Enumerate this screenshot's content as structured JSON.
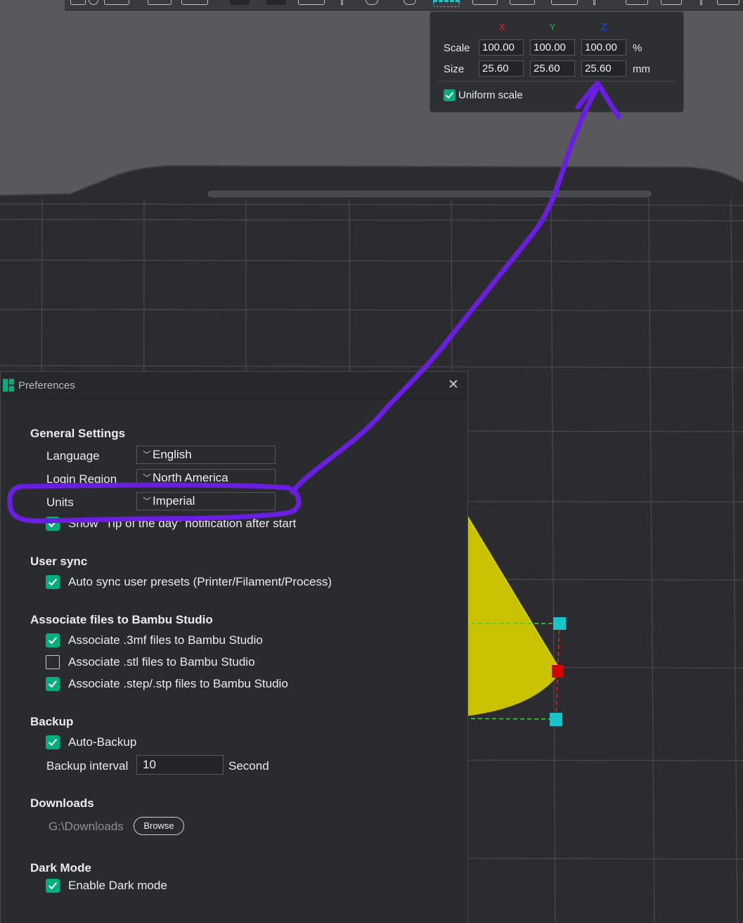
{
  "scale_panel": {
    "axes": [
      "X",
      "Y",
      "Z"
    ],
    "axis_colors": [
      "#e02424",
      "#1fb24a",
      "#2a43e8"
    ],
    "scale_label": "Scale",
    "size_label": "Size",
    "scale_values": [
      "100.00",
      "100.00",
      "100.00"
    ],
    "size_values": [
      "25.60",
      "25.60",
      "25.60"
    ],
    "scale_unit": "%",
    "size_unit": "mm",
    "uniform_scale_label": "Uniform scale",
    "uniform_scale_checked": true
  },
  "preferences": {
    "title": "Preferences",
    "close_glyph": "✕",
    "general": {
      "title": "General Settings",
      "language_label": "Language",
      "language_value": "English",
      "region_label": "Login Region",
      "region_value": "North America",
      "units_label": "Units",
      "units_value": "Imperial",
      "tip_label": "Show \"Tip of the day\" notification after start"
    },
    "user_sync": {
      "title": "User sync",
      "auto_sync_label": "Auto sync user presets (Printer/Filament/Process)"
    },
    "associate": {
      "title": "Associate files to Bambu Studio",
      "items": [
        {
          "label": "Associate .3mf files to Bambu Studio",
          "checked": true
        },
        {
          "label": "Associate .stl files to Bambu Studio",
          "checked": false
        },
        {
          "label": "Associate .step/.stp files to Bambu Studio",
          "checked": true
        }
      ]
    },
    "backup": {
      "title": "Backup",
      "auto_backup_label": "Auto-Backup",
      "interval_label": "Backup interval",
      "interval_value": "10",
      "interval_unit": "Second"
    },
    "downloads": {
      "title": "Downloads",
      "path": "G:\\Downloads",
      "browse_label": "Browse"
    },
    "dark_mode": {
      "title": "Dark Mode",
      "enable_label": "Enable Dark mode"
    }
  },
  "colors": {
    "accent": "#00ae7f",
    "annotation": "#6a1fe0",
    "model": "#c9c200"
  }
}
